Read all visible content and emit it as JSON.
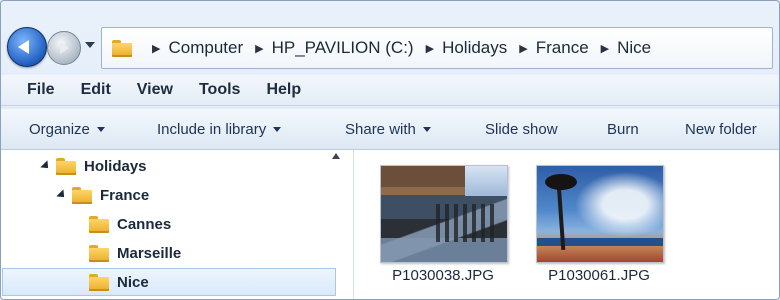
{
  "address_bar": {
    "breadcrumbs": [
      "Computer",
      "HP_PAVILION (C:)",
      "Holidays",
      "France",
      "Nice"
    ]
  },
  "menu": {
    "items": [
      "File",
      "Edit",
      "View",
      "Tools",
      "Help"
    ]
  },
  "toolbar": {
    "organize": "Organize",
    "include_in_library": "Include in library",
    "share_with": "Share with",
    "slide_show": "Slide show",
    "burn": "Burn",
    "new_folder": "New folder"
  },
  "nav_tree": {
    "items": [
      {
        "label": "Holidays",
        "level": 0,
        "expanded": true
      },
      {
        "label": "France",
        "level": 1,
        "expanded": true
      },
      {
        "label": "Cannes",
        "level": 2
      },
      {
        "label": "Marseille",
        "level": 2
      },
      {
        "label": "Nice",
        "level": 2,
        "selected": true
      }
    ]
  },
  "files": [
    {
      "name": "P1030038.JPG"
    },
    {
      "name": "P1030061.JPG"
    }
  ]
}
